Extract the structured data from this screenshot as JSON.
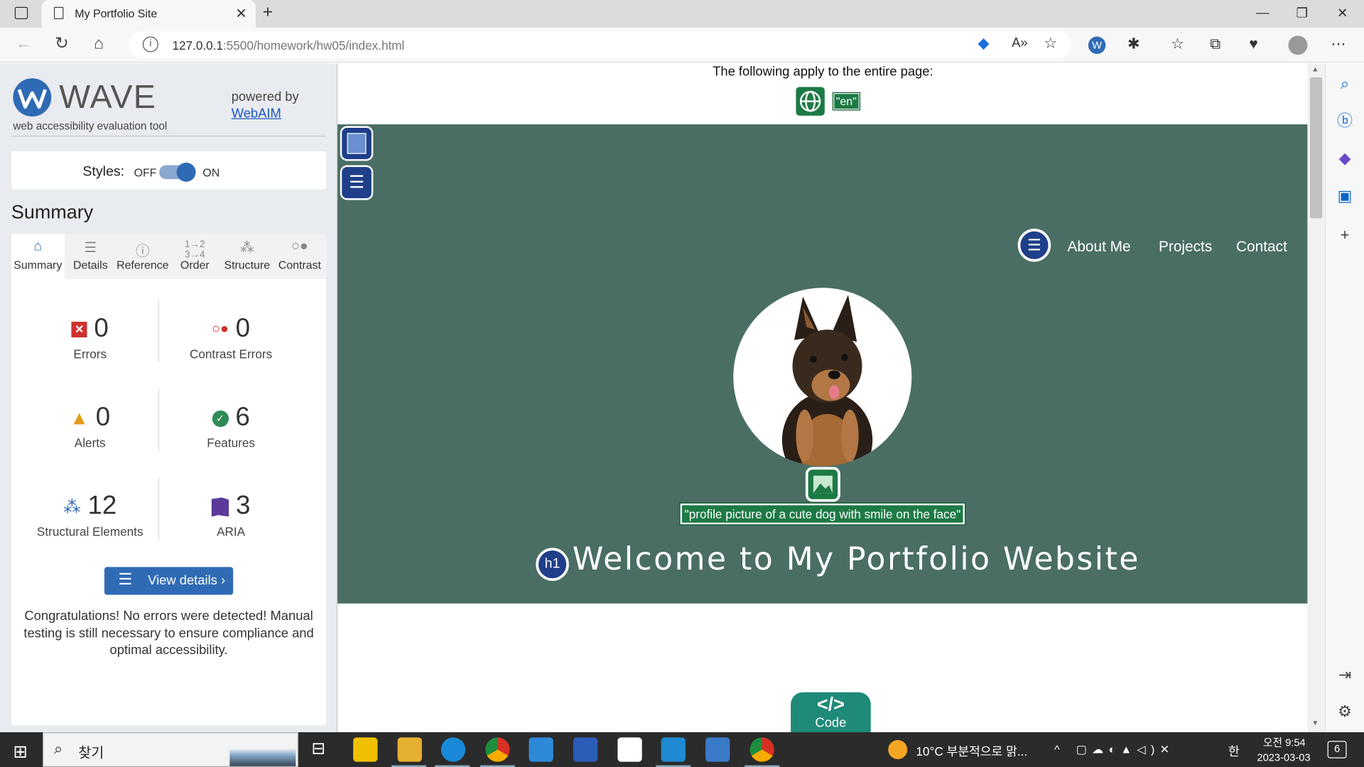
{
  "browser": {
    "tab_title": "My Portfolio Site",
    "url_host": "127.0.0.1",
    "url_rest": ":5500/homework/hw05/index.html"
  },
  "wave": {
    "brand": "WAVE",
    "subtitle": "web accessibility evaluation tool",
    "powered_by": "powered by",
    "webaim": "WebAIM",
    "styles_label": "Styles:",
    "off": "OFF",
    "on": "ON",
    "summary_title": "Summary",
    "tabs": [
      {
        "label": "Summary",
        "icon": "home-icon"
      },
      {
        "label": "Details",
        "icon": "list-icon"
      },
      {
        "label": "Reference",
        "icon": "info-icon"
      },
      {
        "label": "Order",
        "icon": "order-icon"
      },
      {
        "label": "Structure",
        "icon": "structure-icon"
      },
      {
        "label": "Contrast",
        "icon": "contrast-icon"
      }
    ],
    "stats": {
      "errors": {
        "value": "0",
        "label": "Errors",
        "color": "#d0312d"
      },
      "contrast_errors": {
        "value": "0",
        "label": "Contrast Errors",
        "color": "#d0312d"
      },
      "alerts": {
        "value": "0",
        "label": "Alerts",
        "color": "#e39b1b"
      },
      "features": {
        "value": "6",
        "label": "Features",
        "color": "#2e8b57"
      },
      "structural": {
        "value": "12",
        "label": "Structural Elements",
        "color": "#2f6bb5"
      },
      "aria": {
        "value": "3",
        "label": "ARIA",
        "color": "#5b3a99"
      }
    },
    "view_details": "View details ›",
    "congrats": "Congratulations! No errors were detected! Manual testing is still necessary to ensure compliance and optimal accessibility."
  },
  "page": {
    "top_note": "The following apply to the entire page:",
    "lang_badge": "\"en\"",
    "nav": [
      "About Me",
      "Projects",
      "Contact"
    ],
    "alt_text": "\"profile picture of a cute dog with smile on the face\"",
    "h1_badge": "h1",
    "heading": "Welcome to My Portfolio Website",
    "code_label": "Code",
    "code_glyph": "</>",
    "hero_color": "#4a6e64"
  },
  "taskbar": {
    "search": "찾기",
    "weather": "10°C  부분적으로 맑...",
    "time": "오전 9:54",
    "date": "2023-03-03",
    "ime": "한",
    "notif": "6"
  }
}
